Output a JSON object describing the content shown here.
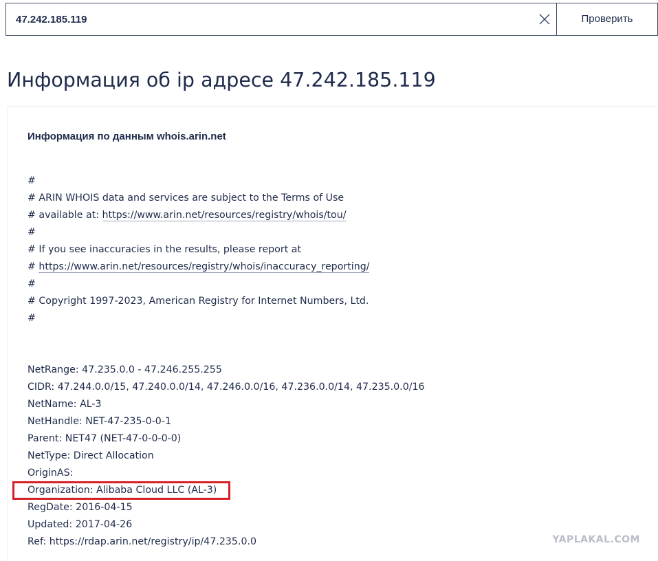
{
  "search": {
    "value": "47.242.185.119",
    "button_label": "Проверить"
  },
  "page": {
    "title": "Информация об ip адресе 47.242.185.119"
  },
  "panel": {
    "heading": "Информация по данным whois.arin.net",
    "comment_lines": [
      "#",
      "# ARIN WHOIS data and services are subject to the Terms of Use",
      "# available at: ",
      "#",
      "# If you see inaccuracies in the results, please report at",
      "# ",
      "#",
      "# Copyright 1997-2023, American Registry for Internet Numbers, Ltd.",
      "#"
    ],
    "links": {
      "terms_url": "https://www.arin.net/resources/registry/whois/tou/",
      "inaccuracy_url": "https://www.arin.net/resources/registry/whois/inaccuracy_reporting/"
    },
    "fields": [
      {
        "key": "NetRange:",
        "value": "47.235.0.0 - 47.246.255.255"
      },
      {
        "key": "CIDR:",
        "value": "47.244.0.0/15, 47.240.0.0/14, 47.246.0.0/16, 47.236.0.0/14, 47.235.0.0/16"
      },
      {
        "key": "NetName:",
        "value": "AL-3"
      },
      {
        "key": "NetHandle:",
        "value": "NET-47-235-0-0-1"
      },
      {
        "key": "Parent:",
        "value": "NET47 (NET-47-0-0-0-0)"
      },
      {
        "key": "NetType:",
        "value": "Direct Allocation"
      },
      {
        "key": "OriginAS:",
        "value": ""
      },
      {
        "key": "Organization:",
        "value": "Alibaba Cloud LLC (AL-3)"
      },
      {
        "key": "RegDate:",
        "value": "2016-04-15"
      },
      {
        "key": "Updated:",
        "value": "2017-04-26"
      },
      {
        "key": "Ref:",
        "value": "https://rdap.arin.net/registry/ip/47.235.0.0"
      }
    ]
  },
  "watermark": "YAPLAKAL.COM",
  "colors": {
    "text": "#1e2b4a",
    "border": "#3a4a66",
    "highlight": "#d62027",
    "watermark": "#b9bec8"
  },
  "icons": {
    "clear": "close-icon"
  }
}
